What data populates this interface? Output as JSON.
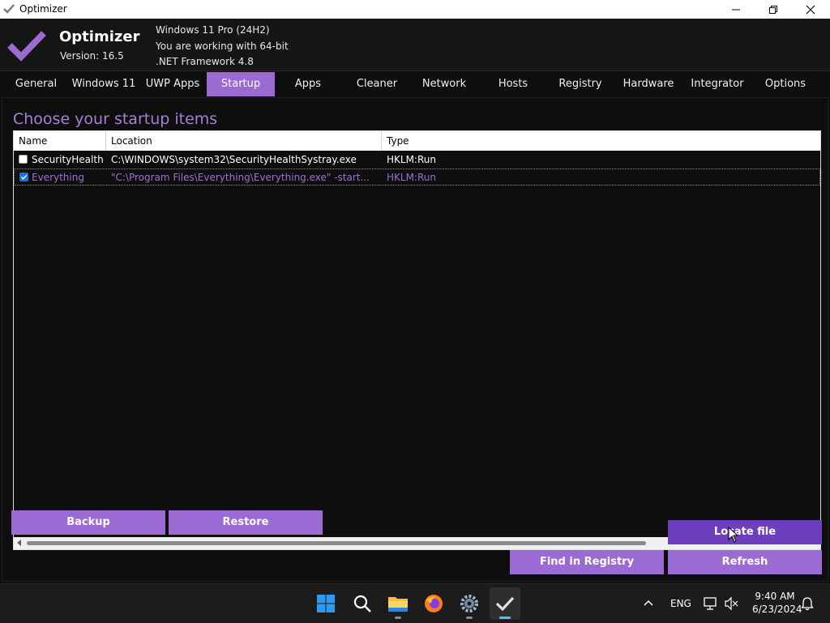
{
  "window": {
    "title": "Optimizer"
  },
  "colors": {
    "accent": "#9b6bd3",
    "accent_dark": "#6d3fbe",
    "heading": "#a57fd8",
    "background": "#0e0e0e"
  },
  "header": {
    "app_name": "Optimizer",
    "version": "Version: 16.5",
    "os": "Windows 11 Pro (24H2)",
    "arch": "You are working with 64-bit",
    "framework": ".NET Framework 4.8"
  },
  "tabs": [
    {
      "label": "General"
    },
    {
      "label": "Windows 11"
    },
    {
      "label": "UWP Apps"
    },
    {
      "label": "Startup"
    },
    {
      "label": "Apps"
    },
    {
      "label": "Cleaner"
    },
    {
      "label": "Network"
    },
    {
      "label": "Hosts"
    },
    {
      "label": "Registry"
    },
    {
      "label": "Hardware"
    },
    {
      "label": "Integrator"
    },
    {
      "label": "Options"
    }
  ],
  "active_tab": "Startup",
  "startup": {
    "heading": "Choose your startup items",
    "columns": [
      "Name",
      "Location",
      "Type"
    ],
    "rows": [
      {
        "checked": false,
        "name": "SecurityHealth",
        "location": "C:\\WINDOWS\\system32\\SecurityHealthSystray.exe",
        "type": "HKLM:Run"
      },
      {
        "checked": true,
        "name": "Everything",
        "location": "\"C:\\Program Files\\Everything\\Everything.exe\" -start...",
        "type": "HKLM:Run"
      }
    ]
  },
  "buttons": {
    "backup": "Backup",
    "restore": "Restore",
    "locate_file": "Locate file",
    "find_in_registry": "Find in Registry",
    "refresh": "Refresh"
  },
  "taskbar": {
    "icons": [
      "windows-start-icon",
      "search-icon",
      "file-explorer-icon",
      "firefox-icon",
      "settings-icon",
      "optimizer-icon"
    ],
    "tray": {
      "language": "ENG",
      "time": "9:40 AM",
      "date": "6/23/2024"
    }
  }
}
